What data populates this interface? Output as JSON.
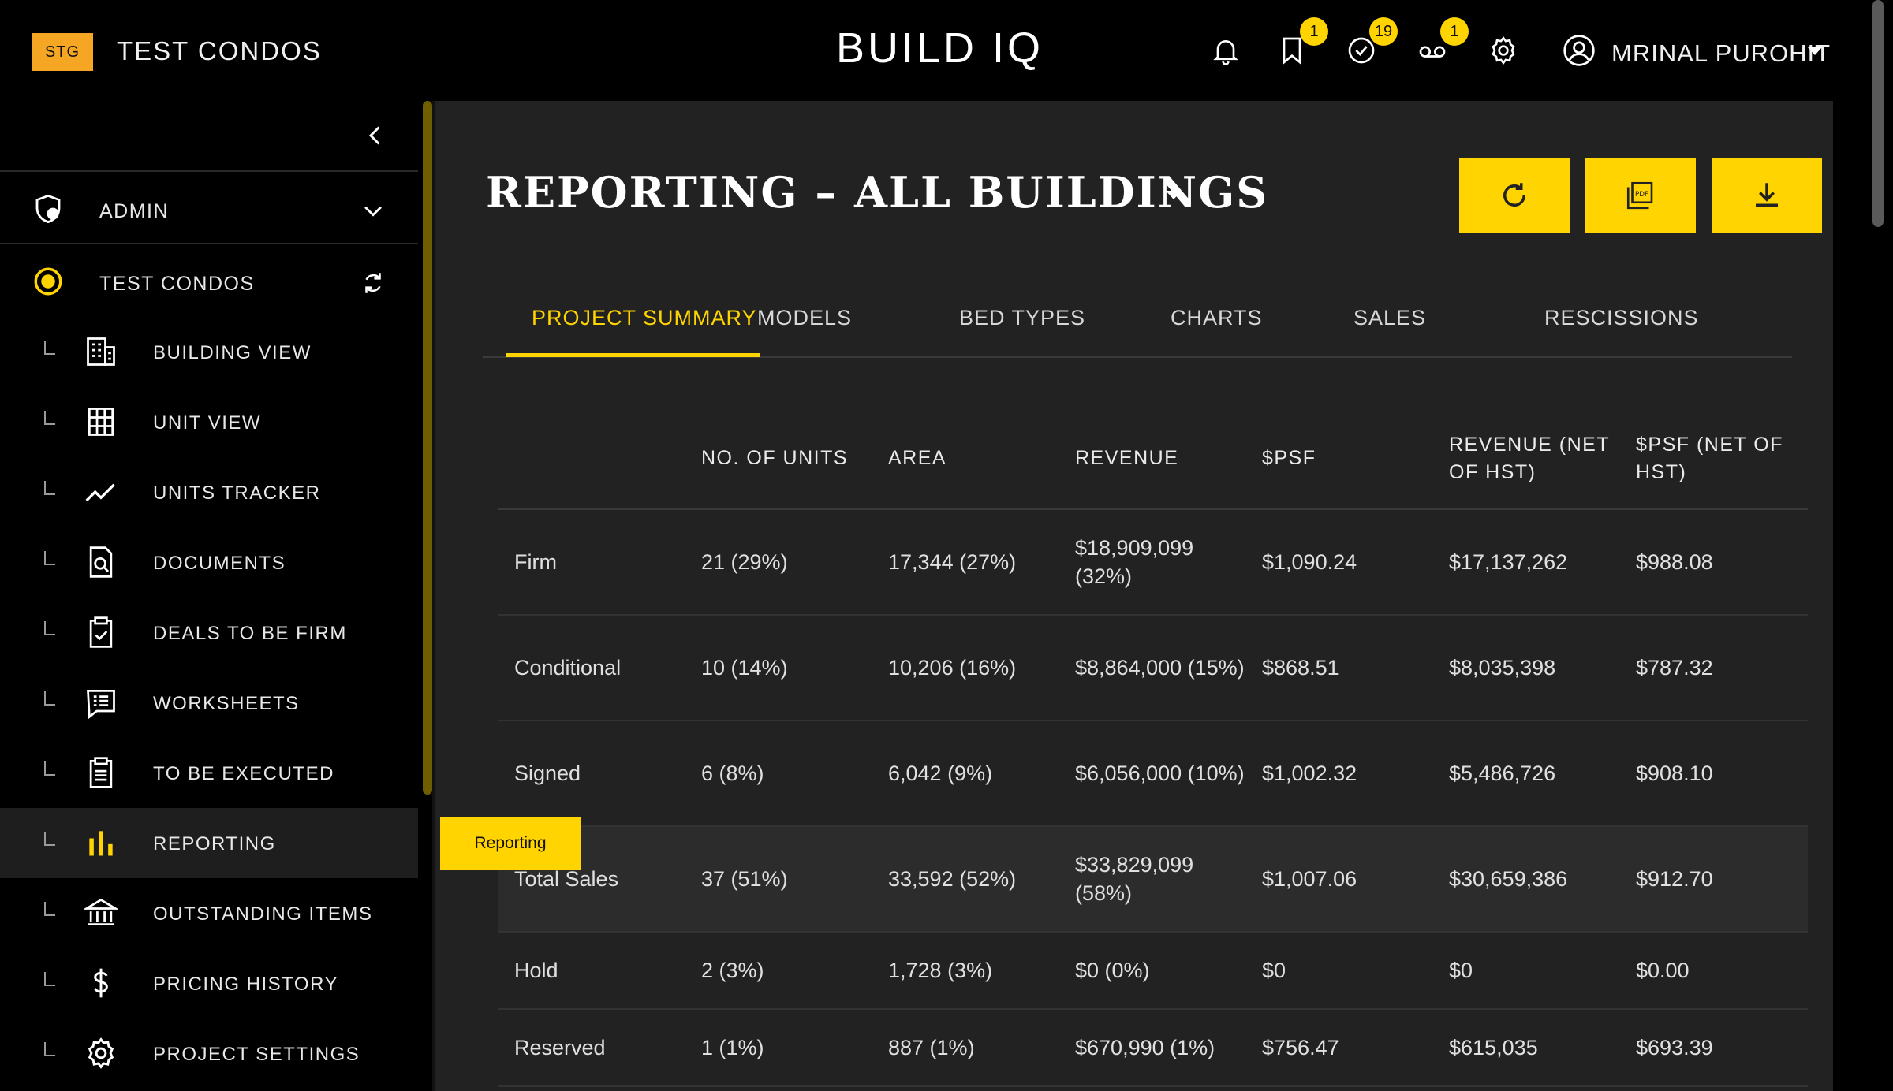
{
  "topbar": {
    "env_badge": "STG",
    "project_name": "TEST CONDOS",
    "app_title": "BUILD IQ",
    "icons": [
      {
        "name": "bell-icon",
        "badge": null
      },
      {
        "name": "bookmark-icon",
        "badge": "1"
      },
      {
        "name": "check-circle-icon",
        "badge": "19"
      },
      {
        "name": "voicemail-icon",
        "badge": "1"
      },
      {
        "name": "gear-icon",
        "badge": null
      }
    ],
    "user_name": "MRINAL PUROHIT"
  },
  "sidebar": {
    "sections": [
      {
        "label": "ADMIN",
        "icon": "shield-user-icon",
        "right_icon": "chevron-down-icon"
      },
      {
        "label": "TEST CONDOS",
        "icon": "target-icon",
        "right_icon": "refresh-icon"
      }
    ],
    "items": [
      {
        "label": "BUILDING VIEW",
        "icon": "building-icon"
      },
      {
        "label": "UNIT VIEW",
        "icon": "grid-building-icon"
      },
      {
        "label": "UNITS TRACKER",
        "icon": "line-chart-icon"
      },
      {
        "label": "DOCUMENTS",
        "icon": "document-search-icon"
      },
      {
        "label": "DEALS TO BE FIRM",
        "icon": "clipboard-check-icon"
      },
      {
        "label": "WORKSHEETS",
        "icon": "list-box-icon"
      },
      {
        "label": "TO BE EXECUTED",
        "icon": "clipboard-list-icon"
      },
      {
        "label": "REPORTING",
        "icon": "bar-chart-icon",
        "active": true
      },
      {
        "label": "OUTSTANDING ITEMS",
        "icon": "bank-icon"
      },
      {
        "label": "PRICING HISTORY",
        "icon": "dollar-icon"
      },
      {
        "label": "PROJECT SETTINGS",
        "icon": "cog-icon"
      }
    ],
    "tooltip": "Reporting"
  },
  "main": {
    "title": "REPORTING – ALL BUILDINGS",
    "actions": [
      "refresh-icon",
      "pdf-icon",
      "download-icon"
    ],
    "tabs": [
      "PROJECT SUMMARY",
      "MODELS",
      "BED TYPES",
      "CHARTS",
      "SALES",
      "RESCISSIONS"
    ],
    "active_tab": "PROJECT SUMMARY",
    "table": {
      "headers": [
        "",
        "NO. OF UNITS",
        "AREA",
        "REVENUE",
        "$PSF",
        "REVENUE (NET OF HST)",
        "$PSF (NET OF HST)"
      ],
      "rows": [
        [
          "Firm",
          "21 (29%)",
          "17,344 (27%)",
          "$18,909,099 (32%)",
          "$1,090.24",
          "$17,137,262",
          "$988.08"
        ],
        [
          "Conditional",
          "10 (14%)",
          "10,206 (16%)",
          "$8,864,000 (15%)",
          "$868.51",
          "$8,035,398",
          "$787.32"
        ],
        [
          "Signed",
          "6 (8%)",
          "6,042 (9%)",
          "$6,056,000 (10%)",
          "$1,002.32",
          "$5,486,726",
          "$908.10"
        ],
        [
          "Total Sales",
          "37 (51%)",
          "33,592 (52%)",
          "$33,829,099 (58%)",
          "$1,007.06",
          "$30,659,386",
          "$912.70"
        ],
        [
          "Hold",
          "2 (3%)",
          "1,728 (3%)",
          "$0 (0%)",
          "$0",
          "$0",
          "$0.00"
        ],
        [
          "Reserved",
          "1 (1%)",
          "887 (1%)",
          "$670,990 (1%)",
          "$756.47",
          "$615,035",
          "$693.39"
        ]
      ]
    }
  }
}
